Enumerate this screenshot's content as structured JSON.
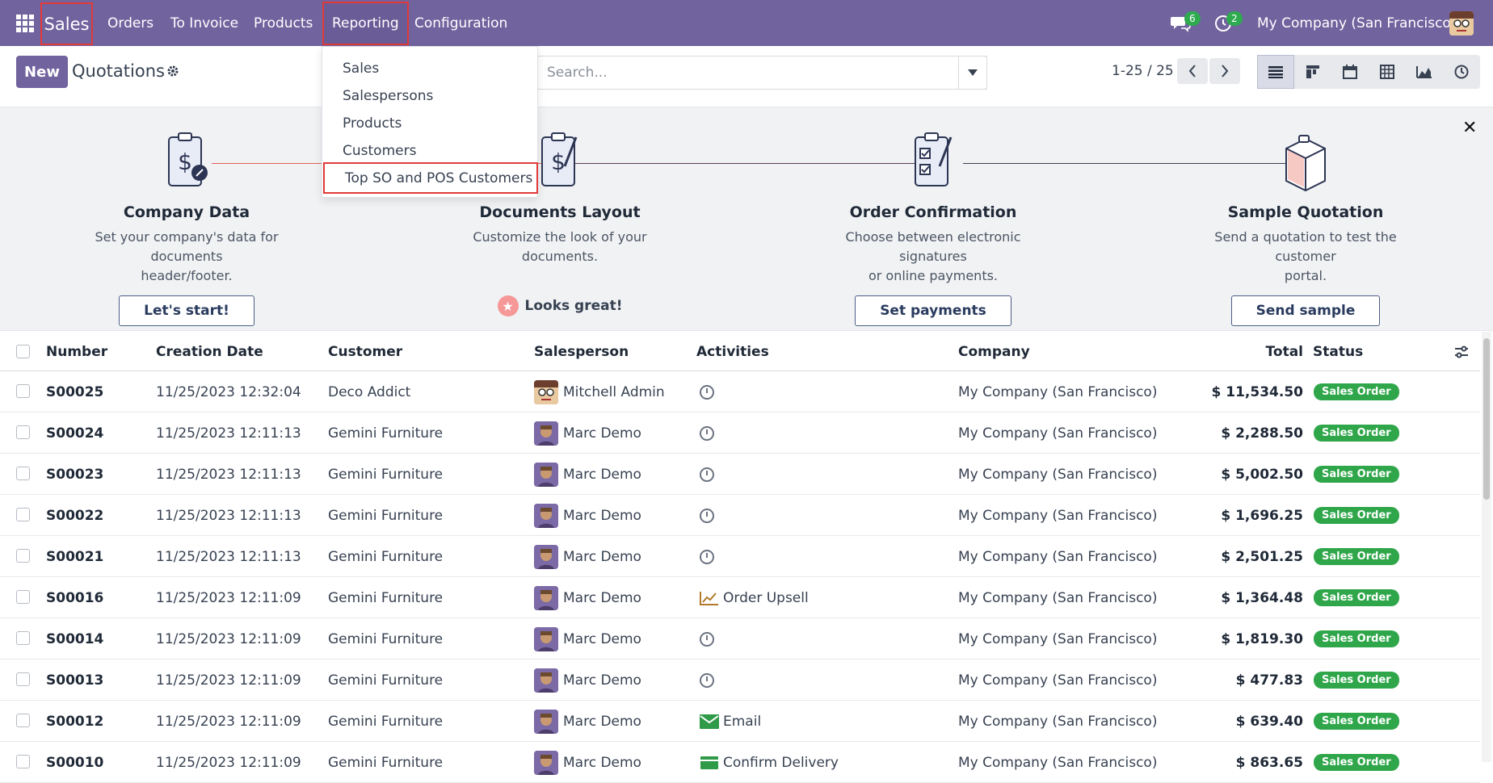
{
  "navbar": {
    "app_name": "Sales",
    "menu": [
      "Orders",
      "To Invoice",
      "Products",
      "Reporting",
      "Configuration"
    ],
    "messages_count": "6",
    "activities_count": "2",
    "company": "My Company (San Francisco)"
  },
  "control_panel": {
    "new_label": "New",
    "title": "Quotations",
    "search_placeholder": "Search...",
    "pager": "1-25 / 25"
  },
  "reporting_menu": {
    "items": [
      "Sales",
      "Salespersons",
      "Products",
      "Customers",
      "Top SO and POS Customers"
    ]
  },
  "banner": {
    "steps": [
      {
        "title": "Company Data",
        "desc1": "Set your company's data for documents",
        "desc2": "header/footer.",
        "button": "Let's start!"
      },
      {
        "title": "Documents Layout",
        "desc1": "Customize the look of your documents.",
        "desc2": "",
        "done": "Looks great!"
      },
      {
        "title": "Order Confirmation",
        "desc1": "Choose between electronic signatures",
        "desc2": "or online payments.",
        "button": "Set payments"
      },
      {
        "title": "Sample Quotation",
        "desc1": "Send a quotation to test the customer",
        "desc2": "portal.",
        "button": "Send sample"
      }
    ]
  },
  "table": {
    "columns": [
      "Number",
      "Creation Date",
      "Customer",
      "Salesperson",
      "Activities",
      "Company",
      "Total",
      "Status"
    ],
    "rows": [
      {
        "number": "S00025",
        "date": "11/25/2023 12:32:04",
        "customer": "Deco Addict",
        "salesperson": "Mitchell Admin",
        "activity": "",
        "company": "My Company (San Francisco)",
        "total": "$ 11,534.50",
        "status": "Sales Order"
      },
      {
        "number": "S00024",
        "date": "11/25/2023 12:11:13",
        "customer": "Gemini Furniture",
        "salesperson": "Marc Demo",
        "activity": "",
        "company": "My Company (San Francisco)",
        "total": "$ 2,288.50",
        "status": "Sales Order"
      },
      {
        "number": "S00023",
        "date": "11/25/2023 12:11:13",
        "customer": "Gemini Furniture",
        "salesperson": "Marc Demo",
        "activity": "",
        "company": "My Company (San Francisco)",
        "total": "$ 5,002.50",
        "status": "Sales Order"
      },
      {
        "number": "S00022",
        "date": "11/25/2023 12:11:13",
        "customer": "Gemini Furniture",
        "salesperson": "Marc Demo",
        "activity": "",
        "company": "My Company (San Francisco)",
        "total": "$ 1,696.25",
        "status": "Sales Order"
      },
      {
        "number": "S00021",
        "date": "11/25/2023 12:11:13",
        "customer": "Gemini Furniture",
        "salesperson": "Marc Demo",
        "activity": "",
        "company": "My Company (San Francisco)",
        "total": "$ 2,501.25",
        "status": "Sales Order"
      },
      {
        "number": "S00016",
        "date": "11/25/2023 12:11:09",
        "customer": "Gemini Furniture",
        "salesperson": "Marc Demo",
        "activity": "Order Upsell",
        "company": "My Company (San Francisco)",
        "total": "$ 1,364.48",
        "status": "Sales Order"
      },
      {
        "number": "S00014",
        "date": "11/25/2023 12:11:09",
        "customer": "Gemini Furniture",
        "salesperson": "Marc Demo",
        "activity": "",
        "company": "My Company (San Francisco)",
        "total": "$ 1,819.30",
        "status": "Sales Order"
      },
      {
        "number": "S00013",
        "date": "11/25/2023 12:11:09",
        "customer": "Gemini Furniture",
        "salesperson": "Marc Demo",
        "activity": "",
        "company": "My Company (San Francisco)",
        "total": "$ 477.83",
        "status": "Sales Order"
      },
      {
        "number": "S00012",
        "date": "11/25/2023 12:11:09",
        "customer": "Gemini Furniture",
        "salesperson": "Marc Demo",
        "activity": "Email",
        "company": "My Company (San Francisco)",
        "total": "$ 639.40",
        "status": "Sales Order"
      },
      {
        "number": "S00010",
        "date": "11/25/2023 12:11:09",
        "customer": "Gemini Furniture",
        "salesperson": "Marc Demo",
        "activity": "Confirm Delivery",
        "company": "My Company (San Francisco)",
        "total": "$ 863.65",
        "status": "Sales Order"
      }
    ]
  }
}
